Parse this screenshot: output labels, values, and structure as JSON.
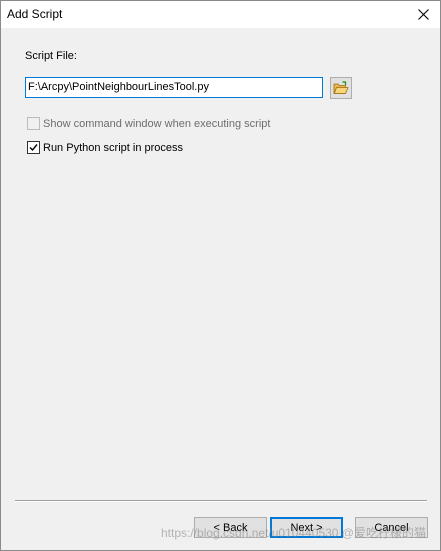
{
  "window": {
    "title": "Add Script"
  },
  "form": {
    "script_file_label": "Script File:",
    "script_file_value": "F:\\Arcpy\\PointNeighbourLinesTool.py",
    "show_cmd_label": "Show command window when executing script",
    "show_cmd_checked": false,
    "show_cmd_enabled": false,
    "run_in_process_label": "Run Python script in process",
    "run_in_process_checked": true
  },
  "buttons": {
    "back": "< Back",
    "next": "Next >",
    "cancel": "Cancel"
  },
  "watermark": "https://blog.csdn.net/u010440530 @爱吃柠檬的猫",
  "icons": {
    "browse": "open-folder-icon",
    "close": "close-icon"
  },
  "colors": {
    "accent": "#0078d7",
    "dialog_bg": "#f0f0f0"
  }
}
